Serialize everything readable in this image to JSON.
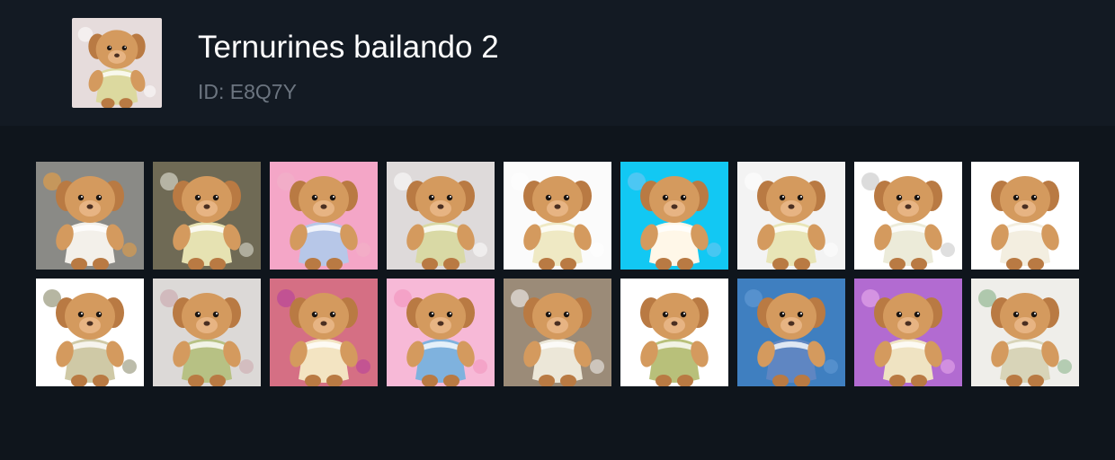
{
  "pack": {
    "title": "Ternurines bailando 2",
    "id_label": "ID: E8Q7Y",
    "thumb_bg": "#e6dcdc"
  },
  "stickers": [
    {
      "icon": "teddy-sticker-icon",
      "bg": "#8a8a86",
      "accent": "#f6a23a",
      "dress": "#f3f0ea"
    },
    {
      "icon": "teddy-sticker-icon",
      "bg": "#6f6a55",
      "accent": "#f0f0e6",
      "dress": "#e6e2b2"
    },
    {
      "icon": "teddy-sticker-icon",
      "bg": "#f4a6c7",
      "accent": "#f1b3c8",
      "dress": "#b7c7e8"
    },
    {
      "icon": "teddy-sticker-icon",
      "bg": "#dedada",
      "accent": "#ffffff",
      "dress": "#d9d9a5"
    },
    {
      "icon": "teddy-sticker-icon",
      "bg": "#fbfbfb",
      "accent": "#ffffff",
      "dress": "#efe9c4"
    },
    {
      "icon": "teddy-sticker-icon",
      "bg": "#12c8f3",
      "accent": "#7bc6f2",
      "dress": "#fff7e8"
    },
    {
      "icon": "teddy-sticker-icon",
      "bg": "#f3f3f3",
      "accent": "#ffffff",
      "dress": "#e8e5b7"
    },
    {
      "icon": "teddy-sticker-icon",
      "bg": "#ffffff",
      "accent": "#bfbfbf",
      "dress": "#ecebd9"
    },
    {
      "icon": "teddy-sticker-icon",
      "bg": "#ffffff",
      "accent": "#ffffff",
      "dress": "#f3eee0"
    },
    {
      "icon": "teddy-sticker-icon",
      "bg": "#ffffff",
      "accent": "#7a7a55",
      "dress": "#cfc9a6"
    },
    {
      "icon": "teddy-sticker-icon",
      "bg": "#dcd9d7",
      "accent": "#c9a1a8",
      "dress": "#b7c184"
    },
    {
      "icon": "teddy-sticker-icon",
      "bg": "#d56f84",
      "accent": "#b13aa0",
      "dress": "#f3e4c2"
    },
    {
      "icon": "teddy-sticker-icon",
      "bg": "#f7b9d7",
      "accent": "#f28fb9",
      "dress": "#7fb2de"
    },
    {
      "icon": "teddy-sticker-icon",
      "bg": "#9b8b78",
      "accent": "#ffffff",
      "dress": "#ece7d8"
    },
    {
      "icon": "teddy-sticker-icon",
      "bg": "#ffffff",
      "accent": "#ffffff",
      "dress": "#b8c07a"
    },
    {
      "icon": "teddy-sticker-icon",
      "bg": "#3f7fc0",
      "accent": "#6aa0d8",
      "dress": "#5f86c2"
    },
    {
      "icon": "teddy-sticker-icon",
      "bg": "#b26bd1",
      "accent": "#f0b4f0",
      "dress": "#efe3c2"
    },
    {
      "icon": "teddy-sticker-icon",
      "bg": "#efeeea",
      "accent": "#7aa97a",
      "dress": "#d8d4b8"
    }
  ]
}
